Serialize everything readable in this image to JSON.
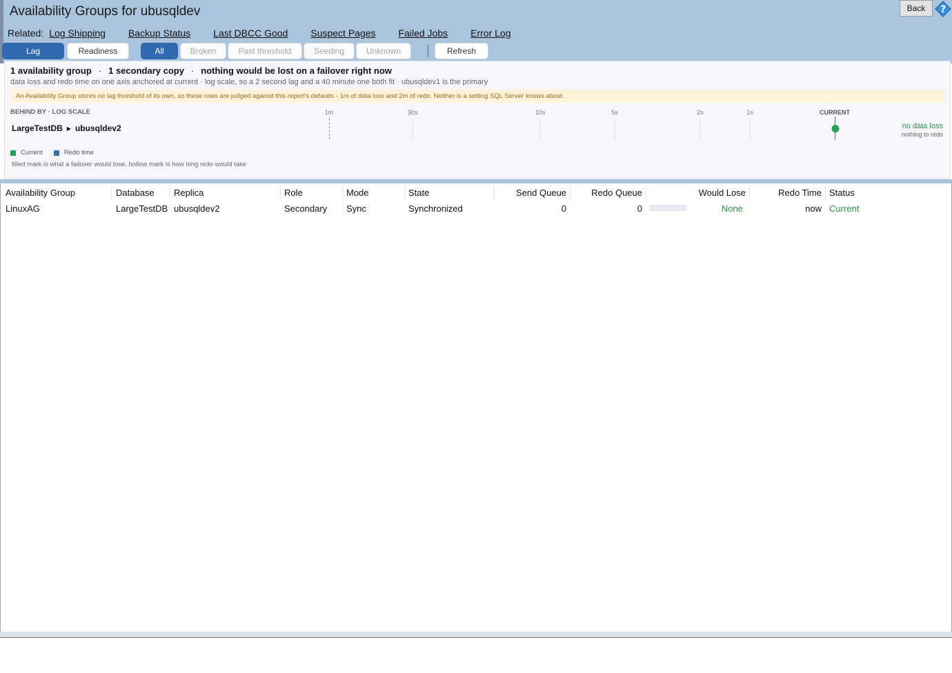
{
  "header": {
    "title": "Availability Groups for ubusqldev",
    "related_label": "Related:",
    "related_links": [
      "Log Shipping",
      "Backup Status",
      "Last DBCC Good",
      "Suspect Pages",
      "Failed Jobs",
      "Error Log"
    ],
    "back_label": "Back",
    "help_icon": "help-icon"
  },
  "toolbar": {
    "view_buttons": [
      "Lag",
      "Readiness"
    ],
    "active_view": "Lag",
    "filter_buttons": [
      "All",
      "Broken",
      "Past threshold",
      "Seeding",
      "Unknown"
    ],
    "active_filter": "All",
    "refresh_label": "Refresh",
    "active_color": "#2f69ae"
  },
  "summary": {
    "headline": {
      "groups": "1 availability group",
      "copies": "1 secondary copy",
      "loss": "nothing would be lost on a failover right now",
      "separator": "·"
    },
    "subtitle": "data loss and redo time on one axis anchored at current · log scale, so a 2 second lag and a 40 minute one both fit  ·  ubusqldev1 is the primary",
    "note": "An Availability Group stores no lag threshold of its own, so these rows are judged against this report's defaults - 1m of data loss and 2m of redo. Neither is a setting SQL Server knows about.",
    "axis_header": "BEHIND BY · LOG SCALE",
    "ticks": [
      "1m",
      "30s",
      "10s",
      "5s",
      "2s",
      "1s"
    ],
    "current_label": "CURRENT",
    "row": {
      "database": "LargeTestDB",
      "replica": "ubusqldev2",
      "loss_text": "no data loss",
      "redo_text": "nothing to redo"
    },
    "legend": [
      {
        "label": "Current",
        "color": "#27a05a"
      },
      {
        "label": "Redo time",
        "color": "#3d6fa6"
      }
    ],
    "legend_note": "filled mark is what a failover would lose, hollow mark is how long redo would take"
  },
  "table": {
    "columns": [
      "Availability Group",
      "Database",
      "Replica",
      "Role",
      "Mode",
      "State",
      "Send Queue",
      "Redo Queue",
      "",
      "Would Lose",
      "Redo Time",
      "Status"
    ],
    "rows": [
      {
        "group": "LinuxAG",
        "database": "LargeTestDB",
        "replica": "ubusqldev2",
        "role": "Secondary",
        "mode": "Sync",
        "state": "Synchronized",
        "send_queue": "0",
        "redo_queue": "0",
        "would_lose": "None",
        "redo_time": "now",
        "status": "Current"
      }
    ],
    "status_color": "#2a8f4a"
  }
}
